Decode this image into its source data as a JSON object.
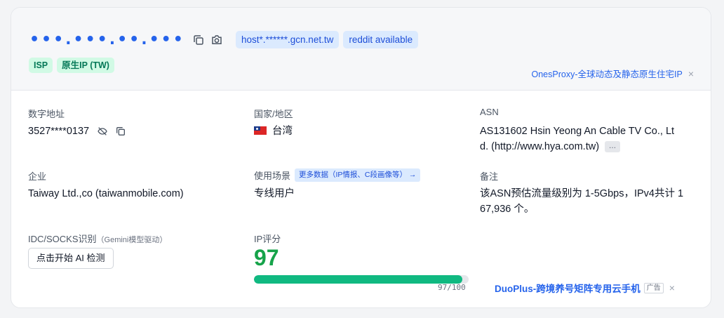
{
  "header": {
    "ip_masked": "•••.•••.••.•••",
    "host_tag": "host*.******.gcn.net.tw",
    "service_tag": "reddit available",
    "tags": [
      "ISP",
      "原生IP (TW)"
    ],
    "promo": "OnesProxy-全球动态及静态原生住宅IP",
    "close": "×"
  },
  "fields": {
    "numeric_addr": {
      "label": "数字地址",
      "value": "3527****0137"
    },
    "country": {
      "label": "国家/地区",
      "value": "台湾"
    },
    "asn": {
      "label": "ASN",
      "value_line1": "AS131602 Hsin Yeong An Cable TV Co., Lt",
      "value_line2": "d. (http://www.hya.com.tw)",
      "more": "..."
    },
    "company": {
      "label": "企业",
      "value": "Taiway Ltd.,co (taiwanmobile.com)"
    },
    "usage": {
      "label": "使用场景",
      "more_link": "更多数据（IP情报、C段画像等） →",
      "value": "专线用户"
    },
    "note": {
      "label": "备注",
      "value_line1": "该ASN预估流量级别为 1-5Gbps，IPv4共计 1",
      "value_line2": "67,936 个。"
    },
    "idc": {
      "label": "IDC/SOCKS识别",
      "label_note": "（Gemini模型驱动）",
      "button": "点击开始 AI 检测"
    },
    "score": {
      "label": "IP评分",
      "value": "97",
      "bar_text": "97/100",
      "fraction": 0.97
    }
  },
  "promo2": {
    "text": "DuoPlus-跨境养号矩阵专用云手机",
    "ad": "广告",
    "close": "×"
  },
  "colors": {
    "accent": "#2563eb",
    "score": "#16a34a",
    "bar": "#10b981"
  }
}
